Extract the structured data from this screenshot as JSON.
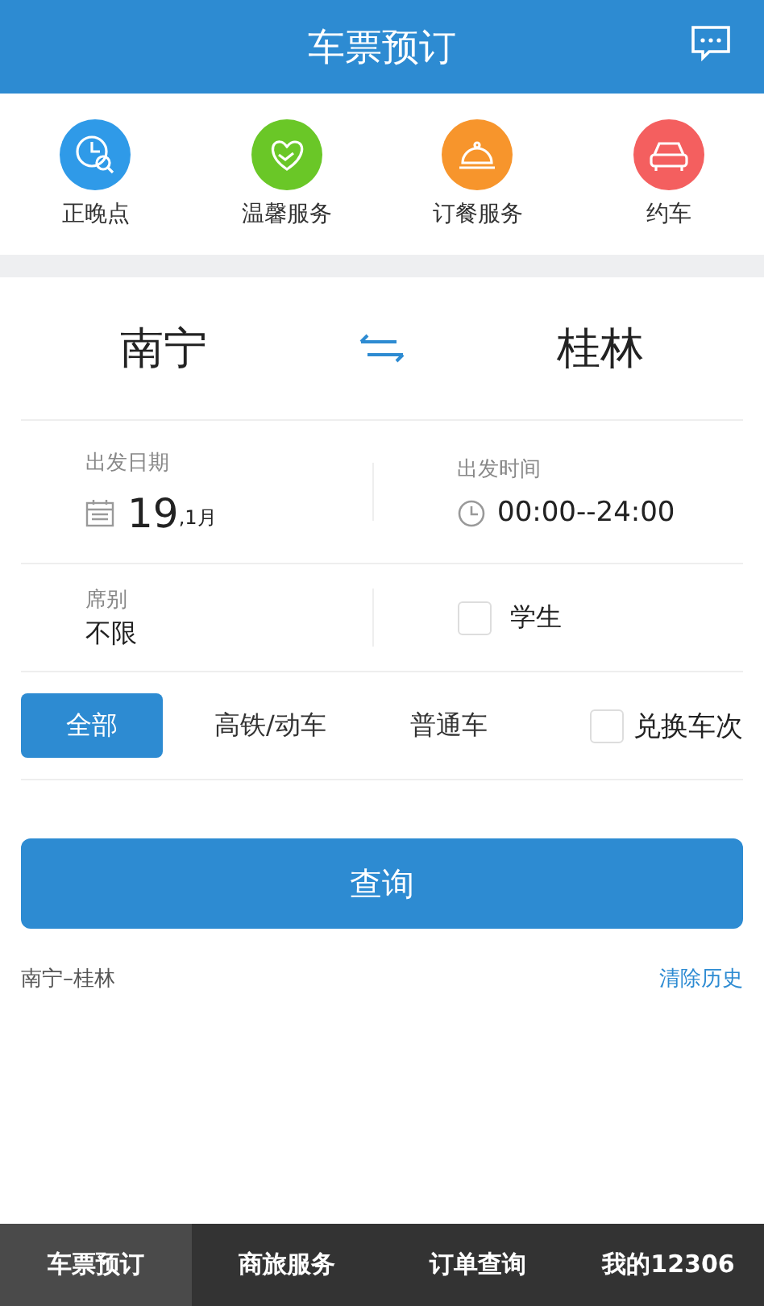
{
  "header": {
    "title": "车票预订"
  },
  "services": [
    {
      "label": "正晚点",
      "kind": "clock",
      "color": "#2f9ae8"
    },
    {
      "label": "温馨服务",
      "kind": "heart",
      "color": "#6ac727"
    },
    {
      "label": "订餐服务",
      "kind": "meal",
      "color": "#f7952c"
    },
    {
      "label": "约车",
      "kind": "car",
      "color": "#f45f5f"
    }
  ],
  "route": {
    "from": "南宁",
    "to": "桂林"
  },
  "date": {
    "label": "出发日期",
    "day": "19",
    "month": ",1月"
  },
  "time": {
    "label": "出发时间",
    "value": "00:00--24:00"
  },
  "seat": {
    "label": "席别",
    "value": "不限"
  },
  "student": {
    "label": "学生",
    "checked": false
  },
  "train_types": [
    {
      "label": "全部",
      "selected": true
    },
    {
      "label": "高铁/动车",
      "selected": false
    },
    {
      "label": "普通车",
      "selected": false
    }
  ],
  "exchange": {
    "label": "兑换车次",
    "checked": false
  },
  "search_button": "查询",
  "history": {
    "item": "南宁–桂林",
    "clear": "清除历史"
  },
  "nav": [
    {
      "label": "车票预订",
      "selected": true
    },
    {
      "label": "商旅服务",
      "selected": false
    },
    {
      "label": "订单查询",
      "selected": false
    },
    {
      "label": "我的12306",
      "selected": false
    }
  ]
}
